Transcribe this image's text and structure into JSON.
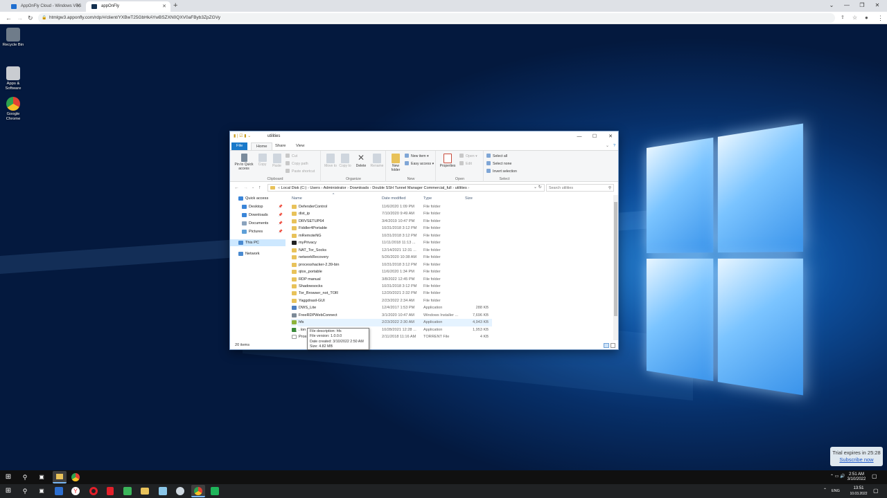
{
  "browser": {
    "tabs": [
      {
        "label": "AppOnFly Cloud - Windows VPS",
        "active": false
      },
      {
        "label": "appOnFly",
        "active": true
      }
    ],
    "url": "htmlgw3.apponfly.com/rdp/#/client/YXBwT25GbHkAYwBSZXN0QXV0aFByb3ZpZGVy"
  },
  "desktop": {
    "icons": [
      {
        "label": "Recycle Bin",
        "color": "#6f7c8a"
      },
      {
        "label": "Apps & Software",
        "color": "#c9ccd1"
      },
      {
        "label": "Google Chrome",
        "color": "#e34133"
      }
    ]
  },
  "explorer": {
    "title": "utilities",
    "ribbon_tabs": [
      "File",
      "Home",
      "Share",
      "View"
    ],
    "clipboard": {
      "pin": "Pin to Quick access",
      "copy": "Copy",
      "paste": "Paste",
      "cut": "Cut",
      "copy_path": "Copy path",
      "paste_shortcut": "Paste shortcut",
      "label": "Clipboard"
    },
    "organize": {
      "move_to": "Move to",
      "copy_to": "Copy to",
      "delete": "Delete",
      "rename": "Rename",
      "label": "Organize"
    },
    "new": {
      "new_folder": "New folder",
      "new_item": "New item",
      "easy_access": "Easy access",
      "label": "New"
    },
    "open": {
      "properties": "Properties",
      "open": "Open",
      "edit": "Edit",
      "label": "Open"
    },
    "select": {
      "select_all": "Select all",
      "select_none": "Select none",
      "invert": "Invert selection",
      "label": "Select"
    },
    "breadcrumb": [
      "Local Disk (C:)",
      "Users",
      "Administrator",
      "Downloads",
      "Double SSH Tunnel Manager Commercial_full",
      "utilities"
    ],
    "search_placeholder": "Search utilities",
    "nav_items": [
      {
        "label": "Quick access",
        "pinned": false
      },
      {
        "label": "Desktop",
        "pinned": true
      },
      {
        "label": "Downloads",
        "pinned": true
      },
      {
        "label": "Documents",
        "pinned": true
      },
      {
        "label": "Pictures",
        "pinned": true
      },
      {
        "label": "This PC",
        "pinned": false
      },
      {
        "label": "Network",
        "pinned": false
      }
    ],
    "columns": [
      "Name",
      "Date modified",
      "Type",
      "Size"
    ],
    "files": [
      {
        "name": "DefenderControl",
        "date": "11/6/2020 1:09 PM",
        "type": "File folder",
        "size": "",
        "kind": "folder"
      },
      {
        "name": "dist_ip",
        "date": "7/10/2020 9:49 AM",
        "type": "File folder",
        "size": "",
        "kind": "folder"
      },
      {
        "name": "DRVSETUP64",
        "date": "3/4/2019 10:47 PM",
        "type": "File folder",
        "size": "",
        "kind": "folder"
      },
      {
        "name": "Fiddler4Portable",
        "date": "10/31/2018 3:12 PM",
        "type": "File folder",
        "size": "",
        "kind": "folder"
      },
      {
        "name": "mRemoteNG",
        "date": "10/31/2018 3:12 PM",
        "type": "File folder",
        "size": "",
        "kind": "folder"
      },
      {
        "name": "myPrivacy",
        "date": "11/11/2018 11:13 ...",
        "type": "File folder",
        "size": "",
        "kind": "special"
      },
      {
        "name": "NAT_Tor_Socks",
        "date": "12/14/2021 12:31 ...",
        "type": "File folder",
        "size": "",
        "kind": "folder"
      },
      {
        "name": "networkRecovery",
        "date": "5/26/2020 10:38 AM",
        "type": "File folder",
        "size": "",
        "kind": "folder"
      },
      {
        "name": "processhacker-2.39-bin",
        "date": "10/31/2018 3:12 PM",
        "type": "File folder",
        "size": "",
        "kind": "folder"
      },
      {
        "name": "qtox_portable",
        "date": "11/6/2020 1:34 PM",
        "type": "File folder",
        "size": "",
        "kind": "folder"
      },
      {
        "name": "RDP manual",
        "date": "3/8/2022 12:45 PM",
        "type": "File folder",
        "size": "",
        "kind": "folder"
      },
      {
        "name": "Shadowsocks",
        "date": "10/31/2018 3:12 PM",
        "type": "File folder",
        "size": "",
        "kind": "folder"
      },
      {
        "name": "Tor_Browser_not_TOR",
        "date": "12/20/2021 2:32 PM",
        "type": "File folder",
        "size": "",
        "kind": "folder"
      },
      {
        "name": "Yaggdrasil-GUI",
        "date": "2/23/2022 2:34 AM",
        "type": "File folder",
        "size": "",
        "kind": "folder"
      },
      {
        "name": "DWS_Lite",
        "date": "12/4/2017 1:53 PM",
        "type": "Application",
        "size": "288 KB",
        "kind": "app"
      },
      {
        "name": "FreeRDPWebConnect",
        "date": "3/1/2020 10:47 AM",
        "type": "Windows Installer ...",
        "size": "7,696 KB",
        "kind": "installer"
      },
      {
        "name": "hfs",
        "date": "2/23/2022 2:30 AM",
        "type": "Application",
        "size": "4,943 KB",
        "kind": "hfs",
        "highlighted": true
      },
      {
        "name": "Hon",
        "date": "10/28/2021 12:28 ...",
        "type": "Application",
        "size": "1,953 KB",
        "kind": "app2"
      },
      {
        "name": "Prox",
        "date": "2/11/2018 11:16 AM",
        "type": "TORRENT File",
        "size": "4 KB",
        "kind": "file"
      }
    ],
    "status": "20 items",
    "tooltip": {
      "desc": "File description: hfs",
      "version": "File version: 1.0.0.0",
      "created": "Date created: 3/10/2022 2:50 AM",
      "size": "Size: 4.82 MB"
    }
  },
  "trial": {
    "text": "Trial expires in 25:28",
    "link": "Subscribe now"
  },
  "remote_clock": {
    "time": "2:51 AM",
    "date": "3/10/2022"
  },
  "local_clock": {
    "lang": "ENG",
    "time": "13:51",
    "date": "10.03.2022"
  },
  "colors": {
    "accent": "#1979ca",
    "folder": "#e8c25a",
    "selection": "#cde8ff"
  }
}
